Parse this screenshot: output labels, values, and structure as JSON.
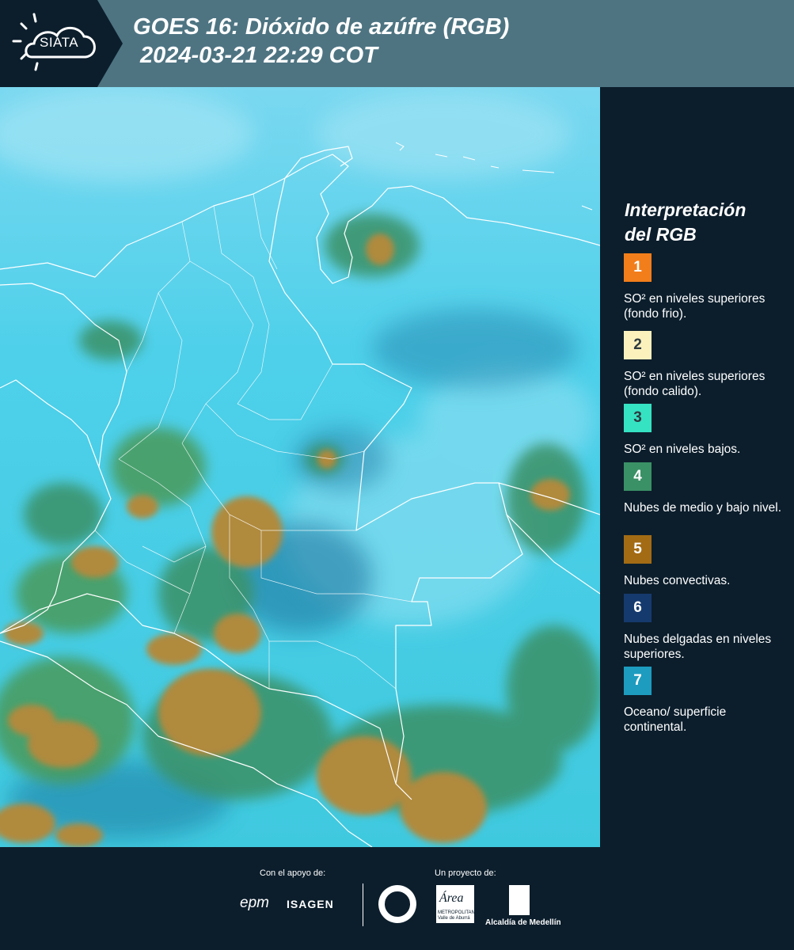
{
  "header": {
    "logo_text": "SIATA",
    "title_line1": "GOES 16: Dióxido de azúfre (RGB)",
    "title_line2": "2024-03-21 22:29 COT"
  },
  "legend": {
    "title_line1": "Interpretación",
    "title_line2": "del RGB",
    "items": [
      {
        "number": "1",
        "color": "#f27e1b",
        "label": "SO² en niveles superiores (fondo frio)."
      },
      {
        "number": "2",
        "color": "#fbf1bd",
        "label": "SO² en niveles superiores (fondo calido)."
      },
      {
        "number": "3",
        "color": "#35e3c3",
        "label": "SO² en niveles bajos."
      },
      {
        "number": "4",
        "color": "#3a9166",
        "label": "Nubes de medio y bajo nivel."
      },
      {
        "number": "5",
        "color": "#a36b14",
        "label": "Nubes convectivas."
      },
      {
        "number": "6",
        "color": "#153a6e",
        "label": "Nubes delgadas en niveles superiores."
      },
      {
        "number": "7",
        "color": "#1d9cbf",
        "label": "Oceano/ superficie continental."
      }
    ]
  },
  "footer": {
    "support_label": "Con el apoyo de:",
    "project_label": "Un proyecto de:",
    "epm_logo": "epm",
    "isagen_logo": "ISAGEN",
    "area_logo": "Área",
    "area_sub": "METROPOLITANA Valle de Aburrá",
    "alcaldia_label": "Alcaldía de Medellín"
  },
  "colors": {
    "header_bg": "#4e7482",
    "panel_bg": "#0c1e2c",
    "sky_cyan": "#40cfe6",
    "cloud_green": "#3a9166",
    "cloud_brown": "#b08a3c"
  },
  "icons": {
    "logo": "sun-cloud-icon"
  }
}
